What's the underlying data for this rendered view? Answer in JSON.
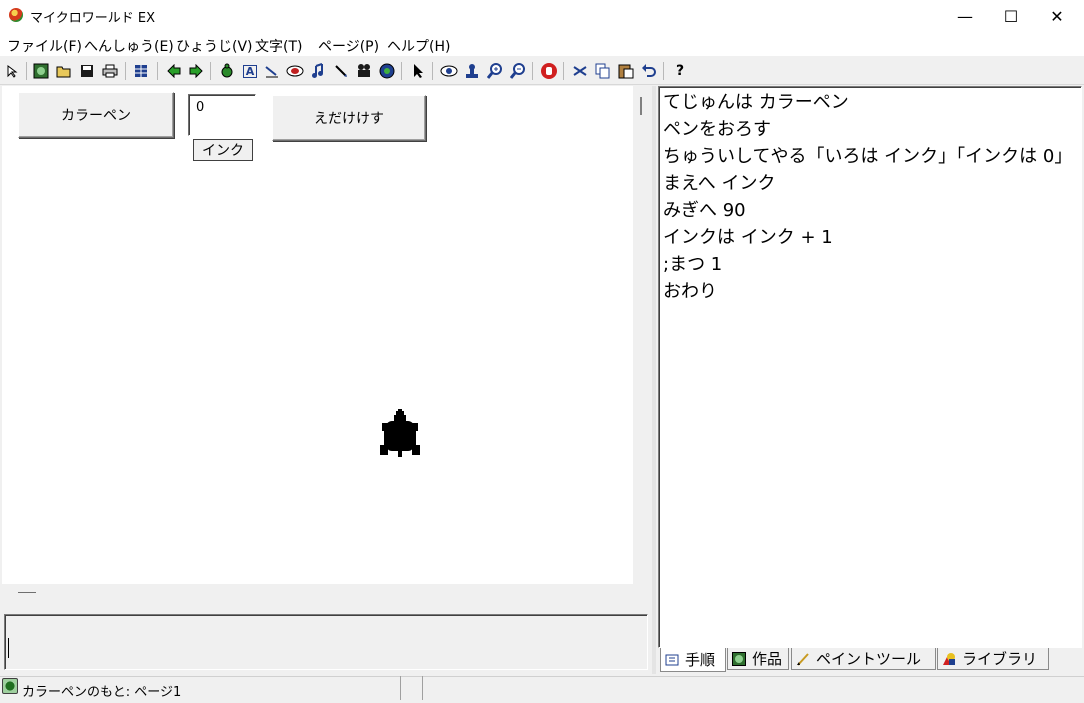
{
  "window": {
    "title": "マイクロワールド EX",
    "minimize": "—",
    "maximize": "☐",
    "close": "✕"
  },
  "menu": [
    {
      "label": "ファイル(F)"
    },
    {
      "label": "へんしゅう(E)"
    },
    {
      "label": "ひょうじ(V)"
    },
    {
      "label": "文字(T)"
    },
    {
      "label": "ページ(P)"
    },
    {
      "label": "ヘルプ(H)"
    }
  ],
  "toolbar": {
    "icons": [
      "pointer-icon",
      "globe-icon",
      "open-folder-icon",
      "save-icon",
      "print-icon",
      "grid-icon",
      "back-arrow-icon",
      "forward-arrow-icon",
      "turtle-icon",
      "text-box-icon",
      "slider-icon",
      "button-tool-icon",
      "music-icon",
      "pen-tool-icon",
      "video-icon",
      "sound-icon",
      "select-arrow-icon",
      "eye-icon",
      "stamp-icon",
      "zoom-in-icon",
      "zoom-out-icon",
      "stop-hand-icon",
      "cut-icon",
      "copy-icon",
      "paste-icon",
      "undo-icon",
      "help-icon"
    ],
    "help_glyph": "?",
    "text_glyph": "A"
  },
  "canvas": {
    "colorpen_button": "カラーペン",
    "erase_button": "えだけけす",
    "ink_value": "0",
    "ink_label": "インク"
  },
  "editor": {
    "lines": [
      "てじゅんは カラーペン",
      "ペンをおろす",
      "ちゅういしてやる「いろは インク」「インクは 0」",
      "まえへ インク",
      "みぎへ 90",
      "インクは インク + 1",
      ";まつ 1",
      "おわり"
    ]
  },
  "tabs": [
    {
      "label": "手順",
      "icon": "procedure-icon"
    },
    {
      "label": "作品",
      "icon": "work-icon"
    },
    {
      "label": "ペイントツール",
      "icon": "paint-tool-icon"
    },
    {
      "label": "ライブラリ",
      "icon": "library-icon"
    }
  ],
  "status": {
    "text": "カラーペンのもと: ページ1"
  }
}
